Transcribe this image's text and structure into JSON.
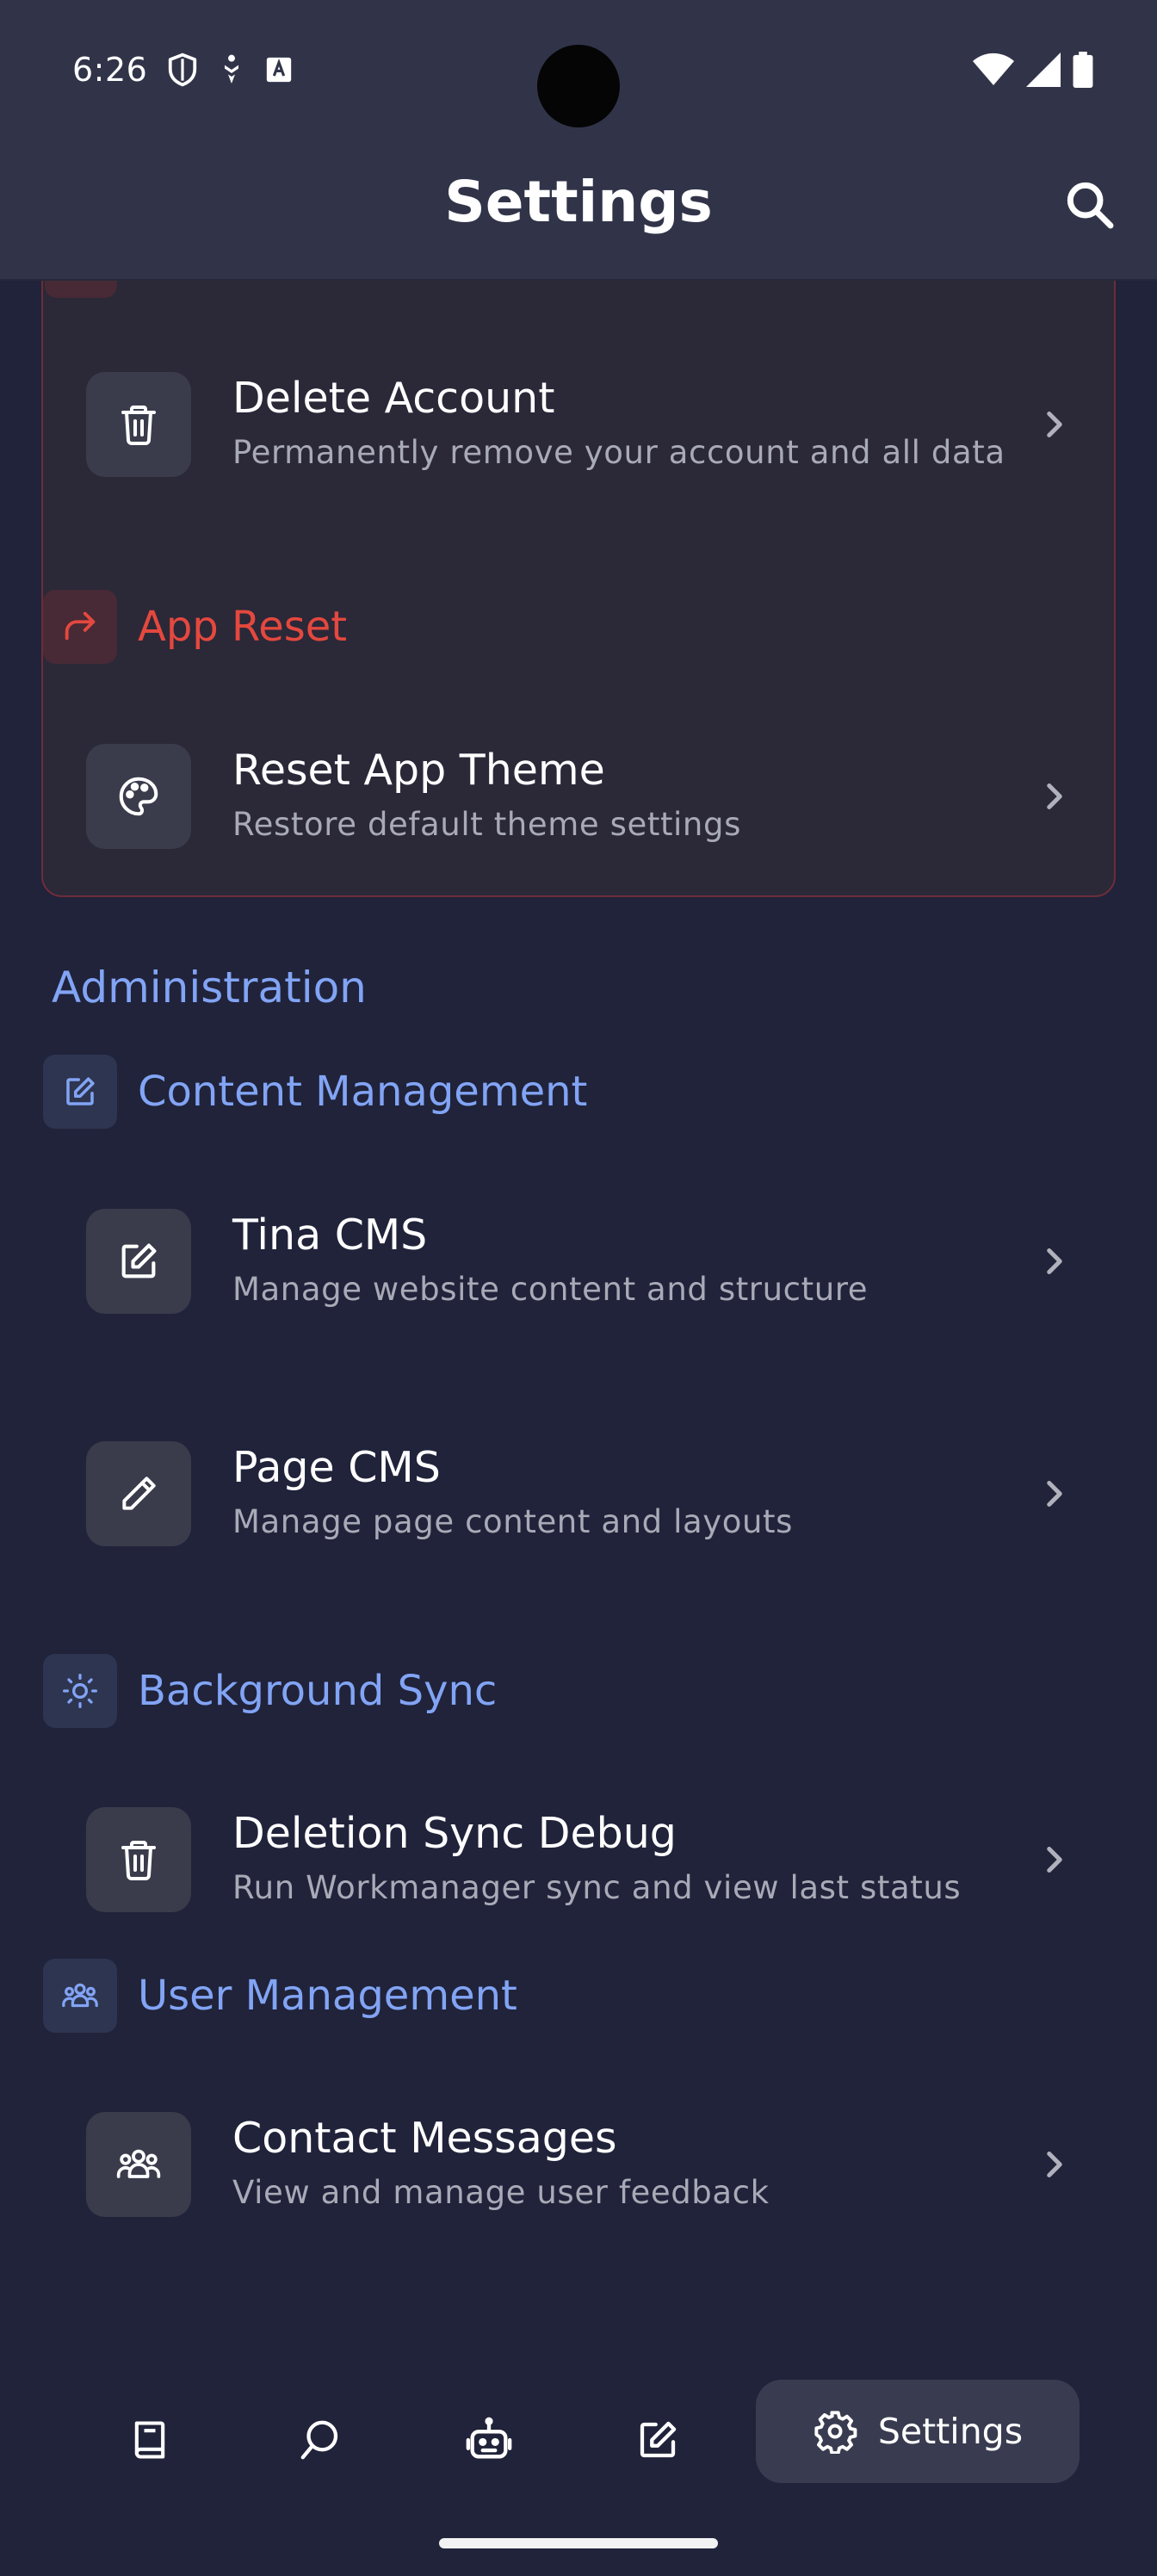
{
  "status_bar": {
    "time": "6:26",
    "left_icons": [
      "shield-icon",
      "accessibility-icon",
      "font-icon"
    ],
    "right_icons": [
      "wifi-icon",
      "signal-icon",
      "battery-icon"
    ]
  },
  "app_bar": {
    "title": "Settings",
    "search_icon": "search-icon"
  },
  "danger_zone": {
    "items": [
      {
        "title": "Delete Account",
        "subtitle": "Permanently remove your account and all data",
        "icon": "trash-icon"
      }
    ],
    "sections": [
      {
        "heading": "App Reset",
        "icon": "redo-arrow-icon",
        "items": [
          {
            "title": "Reset App Theme",
            "subtitle": "Restore default theme settings",
            "icon": "palette-icon"
          }
        ]
      }
    ]
  },
  "administration": {
    "title": "Administration",
    "sections": [
      {
        "heading": "Content Management",
        "icon": "edit-icon",
        "items": [
          {
            "title": "Tina CMS",
            "subtitle": "Manage website content and structure",
            "icon": "edit-icon"
          },
          {
            "title": "Page CMS",
            "subtitle": "Manage page content and layouts",
            "icon": "pencil-icon"
          }
        ]
      },
      {
        "heading": "Background Sync",
        "icon": "sun-icon",
        "items": [
          {
            "title": "Deletion Sync Debug",
            "subtitle": "Run Workmanager sync and view last status",
            "icon": "trash-icon"
          }
        ]
      },
      {
        "heading": "User Management",
        "icon": "users-icon",
        "items": [
          {
            "title": "Contact Messages",
            "subtitle": "View and manage user feedback",
            "icon": "users-icon"
          }
        ]
      }
    ]
  },
  "bottom_nav": {
    "items": [
      {
        "icon": "book-icon",
        "active": false
      },
      {
        "icon": "search-icon",
        "active": false
      },
      {
        "icon": "robot-icon",
        "active": false
      },
      {
        "icon": "edit-icon",
        "active": false
      },
      {
        "icon": "gear-icon",
        "label": "Settings",
        "active": true
      }
    ]
  },
  "colors": {
    "background": "#20233a",
    "app_bar": "#313449",
    "danger_accent": "#e4483e",
    "section_accent": "#82a4f5",
    "tile": "#3a3c4c",
    "subtitle": "#a9aab7"
  }
}
